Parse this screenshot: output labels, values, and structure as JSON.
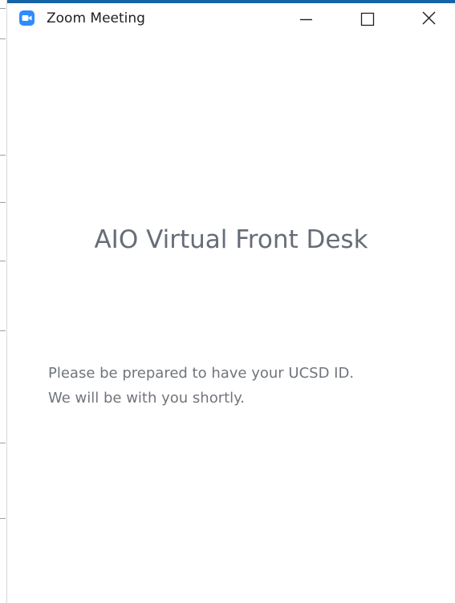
{
  "window": {
    "title": "Zoom Meeting",
    "app_icon": "zoom-camera-icon",
    "controls": {
      "minimize": "minimize-icon",
      "maximize": "maximize-icon",
      "close": "close-icon"
    }
  },
  "main": {
    "heading": "AIO Virtual Front Desk",
    "message_line1": "Please be prepared to have your UCSD ID.",
    "message_line2": "We will be with you shortly."
  },
  "colors": {
    "desktop_blue": "#1565a6",
    "zoom_blue": "#2d8cff",
    "heading_gray": "#676d77",
    "message_gray": "#70757c"
  }
}
